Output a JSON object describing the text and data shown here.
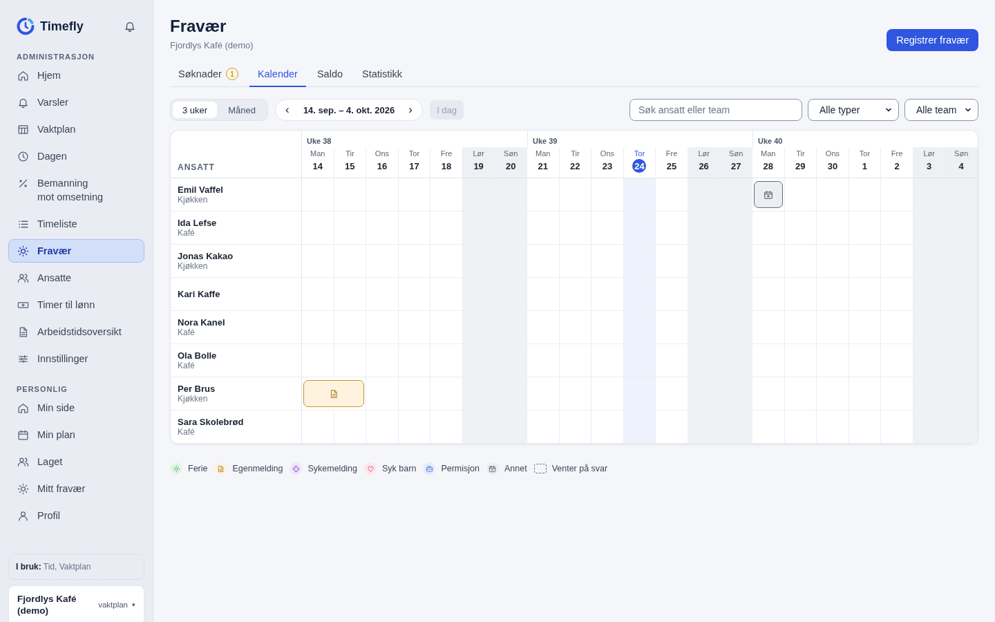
{
  "sidebar": {
    "brand": "Timefly",
    "sections": [
      {
        "heading": "ADMINISTRASJON",
        "items": [
          {
            "label": "Hjem",
            "selected": false
          },
          {
            "label": "Varsler",
            "selected": false
          },
          {
            "label": "Vaktplan",
            "selected": false
          },
          {
            "label": "Dagen",
            "selected": false
          },
          {
            "label": "Bemanning mot omsetning",
            "selected": false
          },
          {
            "label": "Timeliste",
            "selected": false
          },
          {
            "label": "Fravær",
            "selected": true
          },
          {
            "label": "Ansatte",
            "selected": false
          },
          {
            "label": "Timer til lønn",
            "selected": false
          },
          {
            "label": "Arbeidstidsoversikt",
            "selected": false
          },
          {
            "label": "Innstillinger",
            "selected": false
          }
        ]
      },
      {
        "heading": "PERSONLIG",
        "items": [
          {
            "label": "Min side",
            "selected": false
          },
          {
            "label": "Min plan",
            "selected": false
          },
          {
            "label": "Laget",
            "selected": false
          },
          {
            "label": "Mitt fravær",
            "selected": false
          },
          {
            "label": "Profil",
            "selected": false
          }
        ]
      }
    ],
    "in_use": "**I bruk:** Tid, Vaktplan",
    "org": {
      "name": "Fjordlys Kafé (demo)",
      "plan": "vaktplan",
      "caret": "▾"
    }
  },
  "header": {
    "title": "Fravær",
    "subtitle": "Fjordlys Kafé (demo)",
    "action": "Registrer fravær"
  },
  "tabs": [
    {
      "label": "Søknader",
      "badge": "1",
      "selected": false
    },
    {
      "label": "Kalender",
      "selected": true
    },
    {
      "label": "Saldo",
      "selected": false
    },
    {
      "label": "Statistikk",
      "selected": false
    }
  ],
  "toolbar": {
    "views": [
      {
        "label": "3 uker",
        "selected": true
      },
      {
        "label": "Måned",
        "selected": false
      }
    ],
    "prev": "‹",
    "range": "14. sep. – 4. okt. 2026",
    "next": "›",
    "today": {
      "label": "I dag",
      "disabled": true
    },
    "search": {
      "placeholder": "Søk ansatt eller team"
    },
    "type_filter": "Alle typer",
    "team_filter": "Alle team"
  },
  "calendar": {
    "employee_heading": "ANSATT",
    "weeks": [
      {
        "label": "Uke 38",
        "days": [
          {
            "dow": "Man",
            "date": "14",
            "weekend": false,
            "today": false
          },
          {
            "dow": "Tir",
            "date": "15",
            "weekend": false,
            "today": false
          },
          {
            "dow": "Ons",
            "date": "16",
            "weekend": false,
            "today": false
          },
          {
            "dow": "Tor",
            "date": "17",
            "weekend": false,
            "today": false
          },
          {
            "dow": "Fre",
            "date": "18",
            "weekend": false,
            "today": false
          },
          {
            "dow": "Lør",
            "date": "19",
            "weekend": true,
            "today": false
          },
          {
            "dow": "Søn",
            "date": "20",
            "weekend": true,
            "today": false
          }
        ]
      },
      {
        "label": "Uke 39",
        "days": [
          {
            "dow": "Man",
            "date": "21",
            "weekend": false,
            "today": false
          },
          {
            "dow": "Tir",
            "date": "22",
            "weekend": false,
            "today": false
          },
          {
            "dow": "Ons",
            "date": "23",
            "weekend": false,
            "today": false
          },
          {
            "dow": "Tor",
            "date": "24",
            "weekend": false,
            "today": true
          },
          {
            "dow": "Fre",
            "date": "25",
            "weekend": false,
            "today": false
          },
          {
            "dow": "Lør",
            "date": "26",
            "weekend": true,
            "today": false
          },
          {
            "dow": "Søn",
            "date": "27",
            "weekend": true,
            "today": false
          }
        ]
      },
      {
        "label": "Uke 40",
        "days": [
          {
            "dow": "Man",
            "date": "28",
            "weekend": false,
            "today": false
          },
          {
            "dow": "Tir",
            "date": "29",
            "weekend": false,
            "today": false
          },
          {
            "dow": "Ons",
            "date": "30",
            "weekend": false,
            "today": false
          },
          {
            "dow": "Tor",
            "date": "1",
            "weekend": false,
            "today": false
          },
          {
            "dow": "Fre",
            "date": "2",
            "weekend": false,
            "today": false
          },
          {
            "dow": "Lør",
            "date": "3",
            "weekend": true,
            "today": false
          },
          {
            "dow": "Søn",
            "date": "4",
            "weekend": true,
            "today": false
          }
        ]
      }
    ],
    "employees": [
      {
        "name": "Emil Vaffel",
        "team": "Kjøkken",
        "cells": [
          {
            "kind": "empty"
          },
          {
            "kind": "empty"
          },
          {
            "kind": "empty"
          },
          {
            "kind": "empty"
          },
          {
            "kind": "empty"
          },
          {
            "kind": "empty"
          },
          {
            "kind": "empty"
          },
          {
            "kind": "empty"
          },
          {
            "kind": "empty"
          },
          {
            "kind": "empty"
          },
          {
            "kind": "empty"
          },
          {
            "kind": "empty"
          },
          {
            "kind": "empty"
          },
          {
            "kind": "empty"
          },
          {
            "kind": "annet"
          },
          {
            "kind": "empty"
          },
          {
            "kind": "empty"
          },
          {
            "kind": "empty"
          },
          {
            "kind": "empty"
          },
          {
            "kind": "empty"
          },
          {
            "kind": "empty"
          }
        ]
      },
      {
        "name": "Ida Lefse",
        "team": "Kafé"
      },
      {
        "name": "Jonas Kakao",
        "team": "Kjøkken"
      },
      {
        "name": "Kari Kaffe"
      },
      {
        "name": "Nora Kanel",
        "team": "Kafé"
      },
      {
        "name": "Ola Bolle",
        "team": "Kafé"
      },
      {
        "name": "Per Brus",
        "team": "Kjøkken",
        "cells": [
          {
            "kind": "egenmelding"
          },
          {
            "kind": "egenmelding"
          },
          {
            "kind": "empty"
          },
          {
            "kind": "empty"
          },
          {
            "kind": "empty"
          },
          {
            "kind": "empty"
          },
          {
            "kind": "empty"
          },
          {
            "kind": "empty"
          },
          {
            "kind": "empty"
          },
          {
            "kind": "empty"
          },
          {
            "kind": "empty"
          },
          {
            "kind": "empty"
          },
          {
            "kind": "empty"
          },
          {
            "kind": "empty"
          },
          {
            "kind": "empty"
          },
          {
            "kind": "empty"
          },
          {
            "kind": "empty"
          },
          {
            "kind": "empty"
          },
          {
            "kind": "empty"
          },
          {
            "kind": "empty"
          },
          {
            "kind": "empty"
          }
        ]
      },
      {
        "name": "Sara Skolebrød",
        "team": "Kafé"
      }
    ]
  },
  "legend": [
    {
      "kind": "ferie",
      "label": "Ferie"
    },
    {
      "kind": "egenmelding",
      "label": "Egenmelding"
    },
    {
      "kind": "sykemelding",
      "label": "Sykemelding"
    },
    {
      "kind": "syk_barn",
      "label": "Syk barn"
    },
    {
      "kind": "permisjon",
      "label": "Permisjon"
    },
    {
      "kind": "annet",
      "label": "Annet"
    },
    {
      "kind": "pending",
      "label": "Venter på svar"
    }
  ]
}
